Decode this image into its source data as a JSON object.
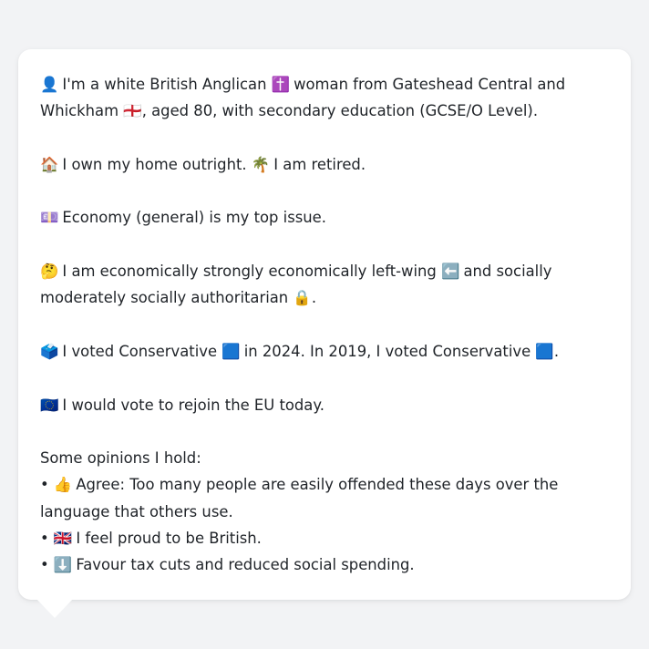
{
  "persona": {
    "identity": {
      "emoji1": "👤",
      "text1": "I'm a white British Anglican",
      "emoji2": "✝️",
      "text2": "woman from Gateshead Central and Whickham",
      "emoji3": "🏴󠁧󠁢󠁥󠁮󠁧󠁿",
      "text3": ", aged 80, with secondary education (GCSE/O Level)."
    },
    "home": {
      "emoji1": "🏠",
      "text1": "I own my home outright.",
      "emoji2": "🌴",
      "text2": "I am retired."
    },
    "issue": {
      "emoji": "💷",
      "text": "Economy (general) is my top issue."
    },
    "ideology": {
      "emoji1": "🤔",
      "text1": "I am economically strongly economically left-wing",
      "emoji2": "⬅️",
      "text2": "and socially moderately socially authoritarian",
      "emoji3": "🔒",
      "text3": "."
    },
    "vote": {
      "emoji1": "🗳️",
      "text1": "I voted Conservative",
      "emoji2": "🟦",
      "text2": "in 2024. In 2019, I voted Conservative",
      "emoji3": "🟦",
      "text3": "."
    },
    "eu": {
      "emoji": "🇪🇺",
      "text": "I would vote to rejoin the EU today."
    },
    "opinions": {
      "heading": "Some opinions I hold:",
      "bullet_char": "•",
      "items": [
        {
          "emoji": "👍",
          "text": "Agree: Too many people are easily offended these days over the language that others use."
        },
        {
          "emoji": "🇬🇧",
          "text": "I feel proud to be British."
        },
        {
          "emoji": "⬇️",
          "text": "Favour tax cuts and reduced social spending."
        }
      ]
    }
  }
}
